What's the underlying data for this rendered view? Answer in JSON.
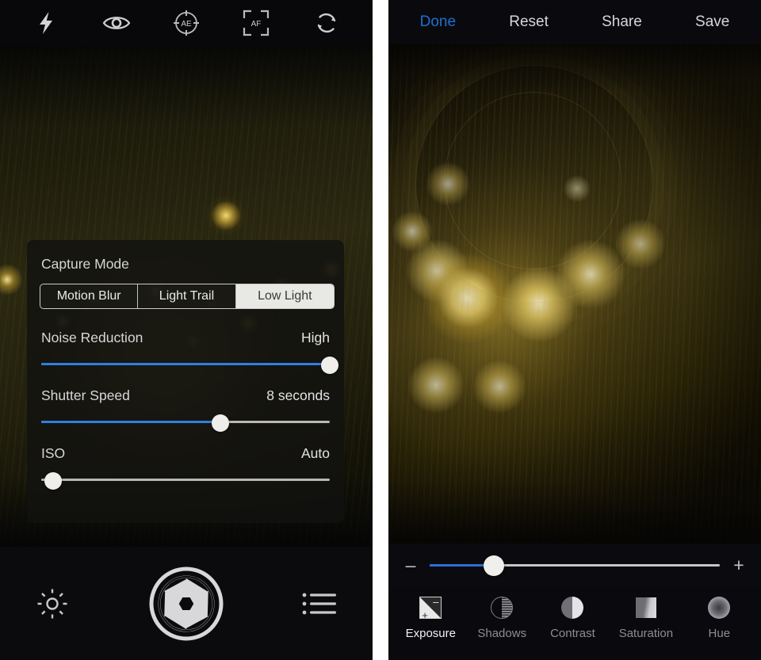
{
  "left_screen": {
    "name": "camera-capture-screen",
    "top_toolbar": {
      "items": [
        {
          "icon": "flash-icon",
          "label": "Flash"
        },
        {
          "icon": "eye-icon",
          "label": "Preview"
        },
        {
          "icon": "ae-lock-icon",
          "label": "AE"
        },
        {
          "icon": "af-lock-icon",
          "label": "AF"
        },
        {
          "icon": "switch-camera-icon",
          "label": "Switch Camera"
        }
      ]
    },
    "settings_panel": {
      "capture_mode": {
        "title": "Capture Mode",
        "options": [
          "Motion Blur",
          "Light Trail",
          "Low Light"
        ],
        "selected": "Low Light",
        "selected_index": 2
      },
      "sliders": [
        {
          "name": "Noise Reduction",
          "value_label": "High",
          "percent": 100,
          "filled": true
        },
        {
          "name": "Shutter Speed",
          "value_label": "8 seconds",
          "percent": 62,
          "filled": true
        },
        {
          "name": "ISO",
          "value_label": "Auto",
          "percent": 4,
          "filled": false
        }
      ]
    },
    "bottom_bar": {
      "settings_icon": "gear-icon",
      "shutter_icon": "aperture-shutter-icon",
      "list_icon": "list-menu-icon"
    }
  },
  "right_screen": {
    "name": "photo-edit-screen",
    "top_toolbar": {
      "actions": [
        {
          "label": "Done",
          "style": "primary"
        },
        {
          "label": "Reset",
          "style": "default"
        },
        {
          "label": "Share",
          "style": "default"
        },
        {
          "label": "Save",
          "style": "default"
        }
      ]
    },
    "adjust_slider": {
      "decrease_label": "–",
      "increase_label": "+",
      "percent": 22
    },
    "tool_tabs": {
      "items": [
        {
          "label": "Exposure",
          "icon": "exposure-icon",
          "active": true
        },
        {
          "label": "Shadows",
          "icon": "shadows-icon",
          "active": false
        },
        {
          "label": "Contrast",
          "icon": "contrast-icon",
          "active": false
        },
        {
          "label": "Saturation",
          "icon": "saturation-icon",
          "active": false
        },
        {
          "label": "Hue",
          "icon": "hue-icon",
          "active": false
        }
      ]
    }
  },
  "colors": {
    "accent_blue": "#2f7fe0",
    "link_blue": "#1f6fd0",
    "track_gray": "#b9b9b4",
    "panel_bg": "rgba(18,18,16,0.80)",
    "bar_bg": "#0b0b0e",
    "text_primary": "#e9e9ea",
    "text_muted": "#8d8d92"
  }
}
